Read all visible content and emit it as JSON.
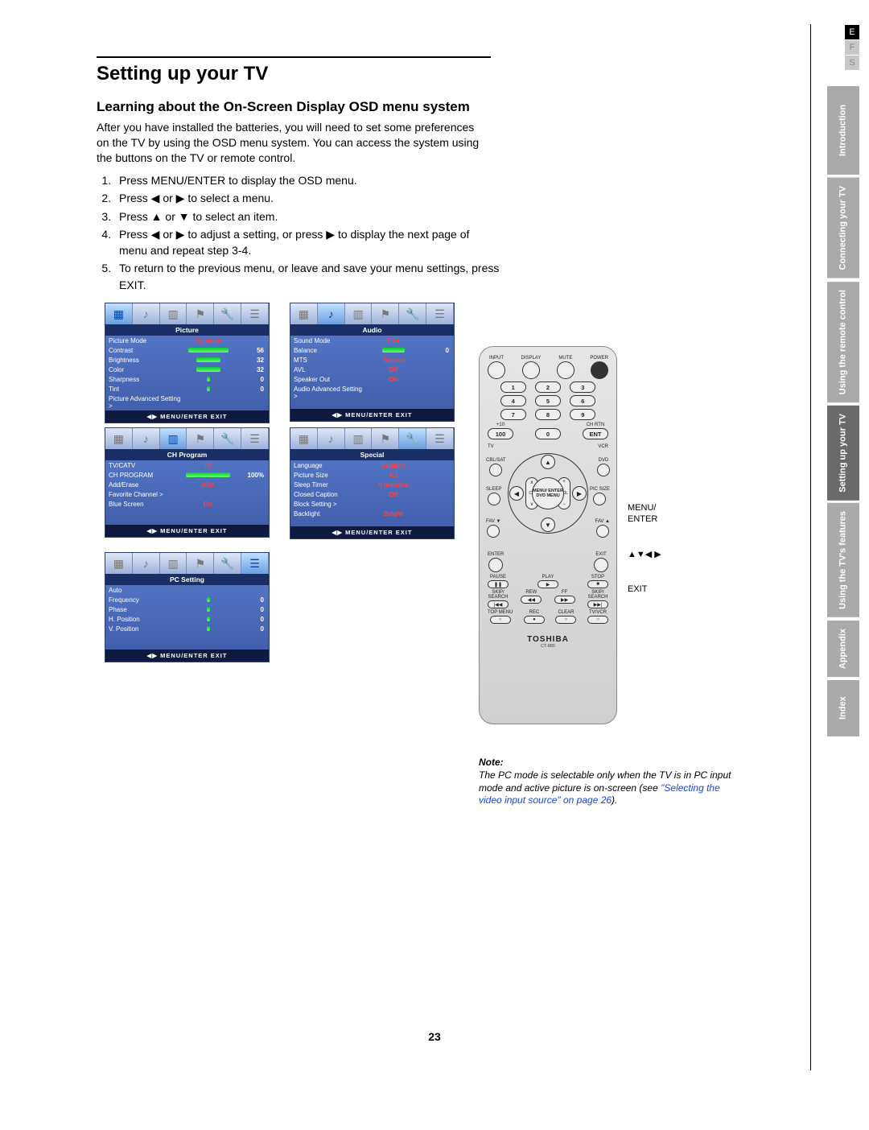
{
  "lang_tabs": [
    "E",
    "F",
    "S"
  ],
  "side_tabs": [
    {
      "label": "Introduction",
      "active": false
    },
    {
      "label": "Connecting your TV",
      "active": false
    },
    {
      "label": "Using the remote control",
      "active": false
    },
    {
      "label": "Setting up your TV",
      "active": true
    },
    {
      "label": "Using the TV's features",
      "active": false
    },
    {
      "label": "Appendix",
      "active": false
    },
    {
      "label": "Index",
      "active": false
    }
  ],
  "title": "Setting up your TV",
  "subtitle": "Learning about the On-Screen Display OSD menu system",
  "intro": "After you have installed the batteries, you will need to set some preferences on the TV by using the OSD menu system. You can access the system using the buttons on the TV or remote control.",
  "steps": [
    "Press MENU/ENTER to display the OSD menu.",
    "Press ◀ or ▶ to select a menu.",
    "Press ▲ or ▼ to select an item.",
    "Press ◀ or ▶ to adjust a setting, or press ▶ to display the next page of menu and repeat step 3-4.",
    "To return to the previous menu, or leave and save your menu settings, press EXIT."
  ],
  "osd_footer": "◀▶ MENU/ENTER EXIT",
  "osd": {
    "picture": {
      "title": "Picture",
      "rows": [
        {
          "k": "Picture Mode",
          "v": "Dynamic",
          "n": ""
        },
        {
          "k": "Contrast",
          "bar": 90,
          "n": "56"
        },
        {
          "k": "Brightness",
          "bar": 55,
          "n": "32"
        },
        {
          "k": "Color",
          "bar": 55,
          "n": "32"
        },
        {
          "k": "Sharpness",
          "bar": 3,
          "n": "0"
        },
        {
          "k": "Tint",
          "bar": 3,
          "n": "0"
        },
        {
          "k": "Picture Advanced Setting >",
          "v": "",
          "n": ""
        }
      ]
    },
    "audio": {
      "title": "Audio",
      "rows": [
        {
          "k": "Sound Mode",
          "v": "Flat",
          "n": ""
        },
        {
          "k": "Balance",
          "bar": 50,
          "n": "0"
        },
        {
          "k": "MTS",
          "v": "Stereo",
          "n": ""
        },
        {
          "k": "AVL",
          "v": "Off",
          "n": ""
        },
        {
          "k": "Speaker Out",
          "v": "On",
          "n": ""
        },
        {
          "k": "Audio Advanced Setting >",
          "v": "",
          "n": ""
        }
      ]
    },
    "ch": {
      "title": "CH Program",
      "rows": [
        {
          "k": "TV/CATV",
          "v": "TV",
          "n": ""
        },
        {
          "k": "CH PROGRAM",
          "bar": 100,
          "n": "100%"
        },
        {
          "k": "Add/Erase",
          "v": "Add",
          "n": ""
        },
        {
          "k": "Favorite Channel >",
          "v": "",
          "n": ""
        },
        {
          "k": "Blue Screen",
          "v": "On",
          "n": ""
        }
      ]
    },
    "special": {
      "title": "Special",
      "rows": [
        {
          "k": "Language",
          "v": "English",
          "n": ""
        },
        {
          "k": "Picture Size",
          "v": "4:3",
          "n": ""
        },
        {
          "k": "Sleep Timer",
          "v": "0 minutes",
          "n": ""
        },
        {
          "k": "Closed Caption",
          "v": "Off",
          "n": ""
        },
        {
          "k": "Block Setting >",
          "v": "",
          "n": ""
        },
        {
          "k": "Backlight",
          "v": "Bright",
          "n": ""
        }
      ]
    },
    "pc": {
      "title": "PC Setting",
      "rows": [
        {
          "k": "Auto",
          "v": "",
          "n": ""
        },
        {
          "k": "Frequency",
          "bar": 3,
          "n": "0"
        },
        {
          "k": "Phase",
          "bar": 3,
          "n": "0"
        },
        {
          "k": "H. Position",
          "bar": 3,
          "n": "0"
        },
        {
          "k": "V. Position",
          "bar": 3,
          "n": "0"
        }
      ]
    }
  },
  "remote": {
    "top_row": [
      "INPUT",
      "DISPLAY",
      "MUTE",
      "POWER"
    ],
    "numpad": [
      [
        "1",
        "2",
        "3"
      ],
      [
        "4",
        "5",
        "6"
      ],
      [
        "7",
        "8",
        "9"
      ]
    ],
    "numpad_bottom_labels": [
      "+10",
      "",
      "CH RTN"
    ],
    "numpad_bottom": [
      "100",
      "0",
      "ENT"
    ],
    "mode_row": [
      "TV",
      "VCR",
      "CBL/SAT",
      "CH",
      "VOL",
      "DVD"
    ],
    "side_btns": {
      "sleep": "SLEEP",
      "picsize": "PIC SIZE",
      "fav_l": "FAV ▼",
      "fav_r": "FAV ▲"
    },
    "center": "MENU/\nENTER\nDVD MENU",
    "bottom_row1": [
      "ENTER",
      "EXIT"
    ],
    "play_row_labels": [
      "PAUSE",
      "PLAY",
      "STOP"
    ],
    "play_row": [
      "❚❚",
      "▶",
      "■"
    ],
    "skip_row_labels": [
      "SKIP/\nSEARCH",
      "REW",
      "FF",
      "SKIP/\nSEARCH"
    ],
    "skip_row": [
      "|◀◀",
      "◀◀",
      "▶▶",
      "▶▶|"
    ],
    "last_row_labels": [
      "TOP MENU",
      "REC",
      "CLEAR",
      "TV/VCR"
    ],
    "last_row": [
      "○",
      "●",
      "○",
      "○"
    ],
    "brand": "TOSHIBA",
    "model": "CT-885"
  },
  "remote_callouts": [
    "MENU/\nENTER",
    "▲▼◀ ▶",
    "EXIT"
  ],
  "note": {
    "header": "Note:",
    "body_pre": "The PC mode is selectable only when the TV is in PC input mode and active picture is on-screen (see ",
    "link": "\"Selecting the video input source\" on page 26",
    "body_post": ")."
  },
  "page_number": "23"
}
